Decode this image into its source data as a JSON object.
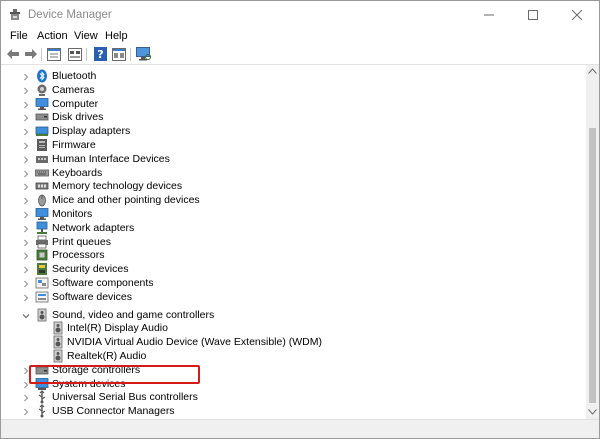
{
  "window": {
    "title": "Device Manager",
    "controls": {
      "minimize": "minimize",
      "maximize": "maximize",
      "close": "close"
    }
  },
  "menu": [
    "File",
    "Action",
    "View",
    "Help"
  ],
  "toolbar": {
    "buttons": [
      "back-arrow-icon",
      "forward-arrow-icon",
      "properties-icon",
      "device-list-icon",
      "help-icon",
      "view-grid-icon",
      "scan-monitor-icon"
    ]
  },
  "tree": {
    "categories": [
      {
        "label": "Bluetooth",
        "icon": "bluetooth-icon",
        "expanded": false
      },
      {
        "label": "Cameras",
        "icon": "camera-icon",
        "expanded": false
      },
      {
        "label": "Computer",
        "icon": "computer-icon",
        "expanded": false
      },
      {
        "label": "Disk drives",
        "icon": "disk-drive-icon",
        "expanded": false
      },
      {
        "label": "Display adapters",
        "icon": "display-adapter-icon",
        "expanded": false
      },
      {
        "label": "Firmware",
        "icon": "firmware-icon",
        "expanded": false
      },
      {
        "label": "Human Interface Devices",
        "icon": "hid-icon",
        "expanded": false
      },
      {
        "label": "Keyboards",
        "icon": "keyboard-icon",
        "expanded": false
      },
      {
        "label": "Memory technology devices",
        "icon": "memory-icon",
        "expanded": false
      },
      {
        "label": "Mice and other pointing devices",
        "icon": "mouse-icon",
        "expanded": false
      },
      {
        "label": "Monitors",
        "icon": "monitor-icon",
        "expanded": false
      },
      {
        "label": "Network adapters",
        "icon": "network-icon",
        "expanded": false
      },
      {
        "label": "Print queues",
        "icon": "printer-icon",
        "expanded": false
      },
      {
        "label": "Processors",
        "icon": "processor-icon",
        "expanded": false
      },
      {
        "label": "Security devices",
        "icon": "security-icon",
        "expanded": false
      },
      {
        "label": "Software components",
        "icon": "software-component-icon",
        "expanded": false
      },
      {
        "label": "Software devices",
        "icon": "software-device-icon",
        "expanded": false
      },
      {
        "label": "Sound, video and game controllers",
        "icon": "speaker-icon",
        "expanded": true,
        "children": [
          {
            "label": "Intel(R) Display Audio",
            "icon": "speaker-icon"
          },
          {
            "label": "NVIDIA Virtual Audio Device (Wave Extensible) (WDM)",
            "icon": "speaker-icon"
          },
          {
            "label": "Realtek(R) Audio",
            "icon": "speaker-icon"
          }
        ]
      },
      {
        "label": "Storage controllers",
        "icon": "storage-icon",
        "expanded": false
      },
      {
        "label": "System devices",
        "icon": "system-icon",
        "expanded": false
      },
      {
        "label": "Universal Serial Bus controllers",
        "icon": "usb-icon",
        "expanded": false
      },
      {
        "label": "USB Connector Managers",
        "icon": "usb-icon",
        "expanded": false
      }
    ]
  },
  "colors": {
    "highlight": "#d51a1a",
    "icon_blue": "#1e73c9",
    "title_gray": "#8a8a8a"
  }
}
